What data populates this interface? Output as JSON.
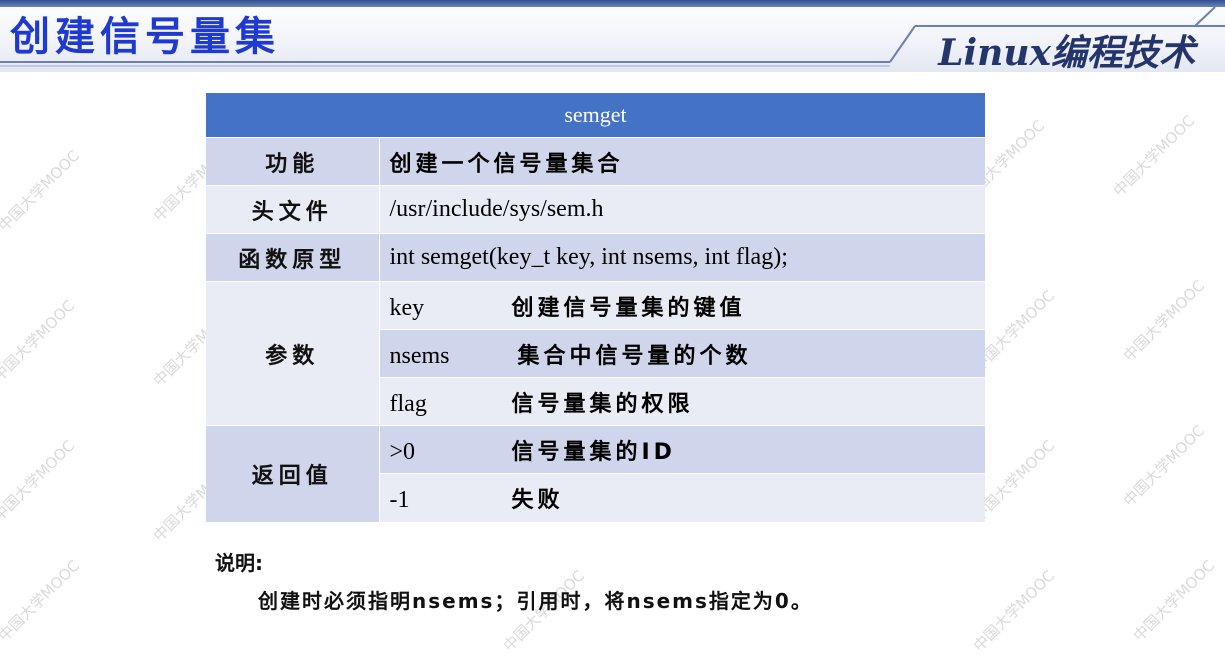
{
  "header": {
    "title": "创建信号量集",
    "brand": "Linux编程技术"
  },
  "watermark": "中国大学MOOC",
  "table": {
    "head": "semget",
    "rows": {
      "function": {
        "label": "功能",
        "value": "创建一个信号量集合"
      },
      "header_file": {
        "label": "头文件",
        "value": "/usr/include/sys/sem.h"
      },
      "prototype": {
        "label": "函数原型",
        "value": "int semget(key_t key, int nsems, int flag);"
      },
      "params": {
        "label": "参数",
        "items": [
          {
            "name": "key",
            "desc": "创建信号量集的键值"
          },
          {
            "name": "nsems",
            "desc": "集合中信号量的个数"
          },
          {
            "name": "flag",
            "desc": "信号量集的权限"
          }
        ]
      },
      "returns": {
        "label": "返回值",
        "items": [
          {
            "name": ">0",
            "desc": "信号量集的ID"
          },
          {
            "name": "-1",
            "desc": "失败"
          }
        ]
      }
    }
  },
  "notes": {
    "heading": "说明:",
    "text": "创建时必须指明nsems；引用时，将nsems指定为0。"
  },
  "colors": {
    "title": "#1f3ad1",
    "table_header": "#4472c4",
    "row_dark": "#cfd5ea",
    "row_light": "#e9ebf5"
  }
}
